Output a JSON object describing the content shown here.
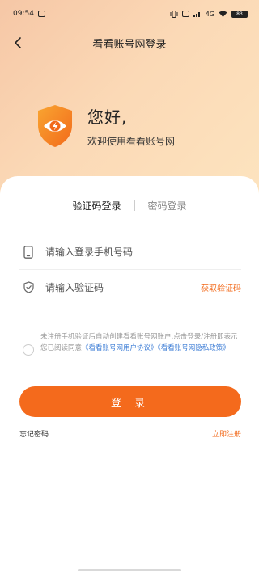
{
  "status_bar": {
    "time": "09:54",
    "network": "4G",
    "battery": "83"
  },
  "nav": {
    "title": "看看账号网登录"
  },
  "hero": {
    "greeting": "您好,",
    "welcome": "欢迎使用看看账号网"
  },
  "tabs": [
    {
      "label": "验证码登录",
      "active": true
    },
    {
      "label": "密码登录",
      "active": false
    }
  ],
  "phone_field": {
    "placeholder": "请输入登录手机号码",
    "value": ""
  },
  "code_field": {
    "placeholder": "请输入验证码",
    "value": "",
    "get_code_label": "获取验证码"
  },
  "agreement": {
    "text": "未注册手机验证后自动创建看看账号网账户,点击登录/注册即表示您已阅读同意",
    "link1": "《看看账号网用户协议》",
    "link2": "《看看账号网隐私政策》"
  },
  "login_button": {
    "label": "登 录"
  },
  "links": {
    "forgot": "忘记密码",
    "register": "立即注册"
  },
  "colors": {
    "accent": "#f46a1c",
    "link": "#3a7bd5"
  }
}
